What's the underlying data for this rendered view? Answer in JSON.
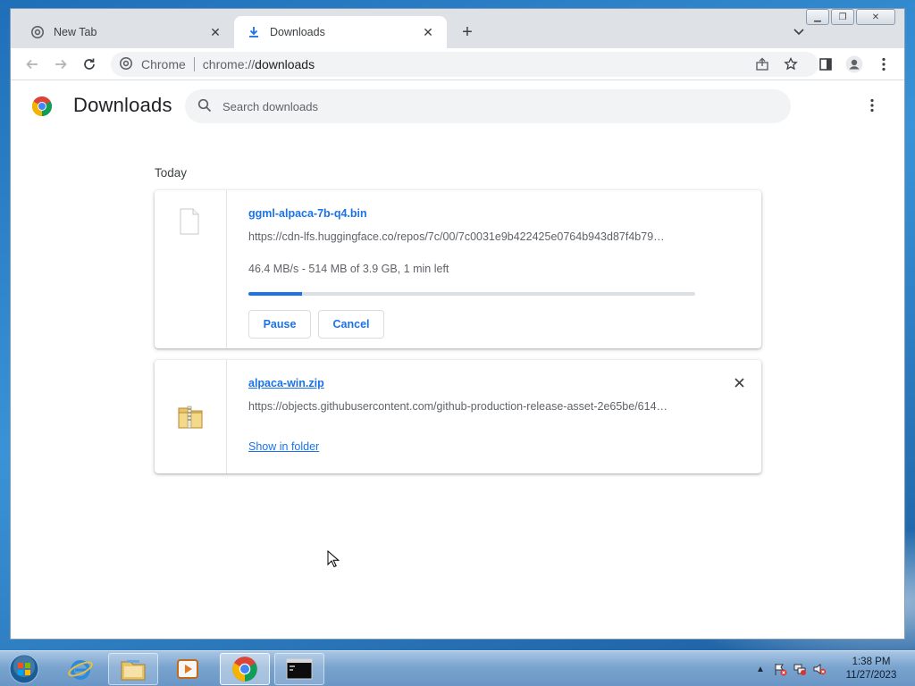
{
  "browser": {
    "tabs": [
      {
        "title": "New Tab",
        "active": false,
        "icon": "chrome-icon"
      },
      {
        "title": "Downloads",
        "active": true,
        "icon": "download-icon"
      }
    ],
    "new_tab_label": "+",
    "address_bar": {
      "site_chip": "Chrome",
      "url_scheme": "chrome://",
      "url_host": "downloads"
    }
  },
  "downloads_page": {
    "title": "Downloads",
    "search": {
      "placeholder": "Search downloads",
      "value": ""
    },
    "date_group": "Today",
    "items": [
      {
        "filename": "ggml-alpaca-7b-q4.bin",
        "url": "https://cdn-lfs.huggingface.co/repos/7c/00/7c0031e9b422425e0764b943d87f4b79…",
        "status": "46.4 MB/s - 514 MB of 3.9 GB, 1 min left",
        "progress": 0.12,
        "buttons": {
          "pause": "Pause",
          "cancel": "Cancel"
        },
        "icon": "generic-file-icon"
      },
      {
        "filename": "alpaca-win.zip",
        "url": "https://objects.githubusercontent.com/github-production-release-asset-2e65be/614…",
        "action_link": "Show in folder",
        "icon": "zip-folder-icon"
      }
    ]
  },
  "taskbar": {
    "apps": [
      "internet-explorer-icon",
      "file-explorer-icon",
      "media-player-icon",
      "chrome-icon",
      "cmd-icon"
    ],
    "clock": {
      "time": "1:38 PM",
      "date": "11/27/2023"
    }
  },
  "colors": {
    "accent": "#1a73e8",
    "tabstrip": "#dee1e6",
    "page_bg": "#ffffff"
  }
}
